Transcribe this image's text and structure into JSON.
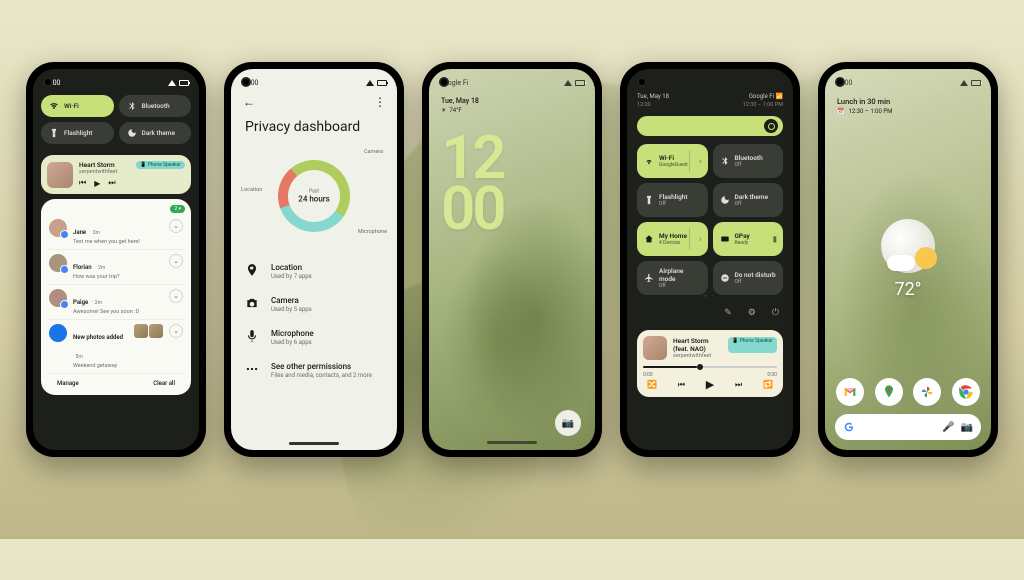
{
  "status_time": "12:00",
  "phone1": {
    "qs": [
      {
        "label": "Wi-Fi",
        "icon": "wifi",
        "active": true
      },
      {
        "label": "Bluetooth",
        "icon": "bluetooth",
        "active": false
      },
      {
        "label": "Flashlight",
        "icon": "flashlight",
        "active": false
      },
      {
        "label": "Dark theme",
        "icon": "dark",
        "active": false
      }
    ],
    "music": {
      "title": "Heart Storm",
      "artist": "serpentwithfeet",
      "device_chip": "📱 Phone Speaker"
    },
    "conv_badge": "2 ▾",
    "notifications": [
      {
        "name": "Jane",
        "time": "2m",
        "body": "Text me when you get here!",
        "avatar": "#c9a08b"
      },
      {
        "name": "Florian",
        "time": "2m",
        "body": "How was your trip?",
        "avatar": "#a8957c"
      },
      {
        "name": "Paige",
        "time": "2m",
        "body": "Awesome! See you soon :D",
        "avatar": "#b08f80"
      }
    ],
    "photos_notif": {
      "title": "New photos added",
      "time": "5m",
      "sub": "Weekend getaway"
    },
    "manage": "Manage",
    "clear": "Clear all"
  },
  "phone2": {
    "title": "Privacy dashboard",
    "chart_center_top": "Past",
    "chart_center_bottom": "24 hours",
    "labels": {
      "camera": "Camera",
      "microphone": "Microphone",
      "location": "Location"
    },
    "perms": [
      {
        "icon": "location",
        "title": "Location",
        "sub": "Used by 7 apps"
      },
      {
        "icon": "camera",
        "title": "Camera",
        "sub": "Used by 5 apps"
      },
      {
        "icon": "mic",
        "title": "Microphone",
        "sub": "Used by 6 apps"
      },
      {
        "icon": "more",
        "title": "See other permissions",
        "sub": "Files and media, contacts, and 2 more"
      }
    ]
  },
  "chart_data": {
    "type": "pie",
    "title": "Past 24 hours",
    "series": [
      {
        "name": "Camera",
        "value": 35,
        "color": "#b0cc5e"
      },
      {
        "name": "Microphone",
        "value": 35,
        "color": "#86d7ce"
      },
      {
        "name": "Location",
        "value": 20,
        "color": "#e57865"
      },
      {
        "name": "Other",
        "value": 10,
        "color": "#b0cc5e"
      }
    ]
  },
  "phone3": {
    "carrier": "Google Fi",
    "date": "Tue, May 18",
    "temp": "74°F",
    "time_top": "12",
    "time_bot": "00"
  },
  "phone4": {
    "date": "Tue, May 18",
    "carrier": "Google Fi 📶",
    "time": "12:00",
    "time_sub": "12:30 – 1:00 PM",
    "tiles": [
      {
        "t": "Wi-Fi",
        "s": "GoogleGuest",
        "on": true,
        "chevron": true
      },
      {
        "t": "Bluetooth",
        "s": "Off",
        "on": false
      },
      {
        "t": "Flashlight",
        "s": "Off",
        "on": false
      },
      {
        "t": "Dark theme",
        "s": "Off",
        "on": false
      },
      {
        "t": "My Home",
        "s": "4 Devices",
        "on": true,
        "chevron": true
      },
      {
        "t": "GPay",
        "s": "Ready",
        "on": true,
        "card": true
      },
      {
        "t": "Airplane mode",
        "s": "Off",
        "on": false
      },
      {
        "t": "Do not disturb",
        "s": "Off",
        "on": false
      }
    ],
    "music": {
      "title": "Heart Storm (feat. NAO)",
      "artist": "serpentwithfeet",
      "chip": "📱 Phone Speaker",
      "elapsed": "0:00",
      "total": "0:00"
    }
  },
  "phone5": {
    "glance": "Lunch in 30 min",
    "glance_sub": "12:30 – 1:00 PM",
    "temp": "72°"
  }
}
